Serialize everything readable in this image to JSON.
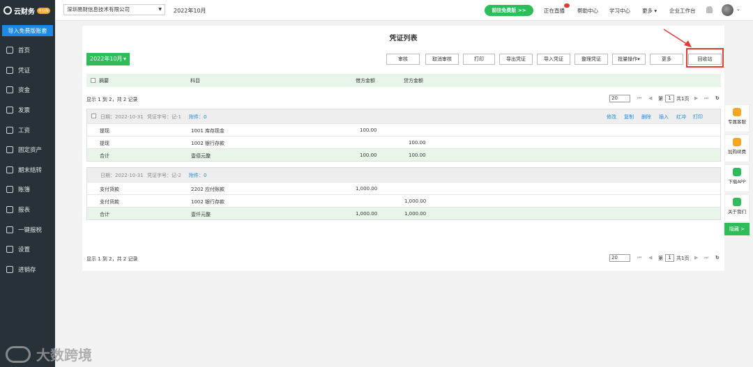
{
  "sidebar": {
    "logo_text": "云财务",
    "logo_badge": "专业版",
    "import_button": "导入免费版账套",
    "items": [
      {
        "label": "首页",
        "icon": "home-icon"
      },
      {
        "label": "凭证",
        "icon": "voucher-icon"
      },
      {
        "label": "资金",
        "icon": "funds-icon"
      },
      {
        "label": "发票",
        "icon": "invoice-icon"
      },
      {
        "label": "工资",
        "icon": "salary-icon"
      },
      {
        "label": "固定资产",
        "icon": "assets-icon"
      },
      {
        "label": "期末结转",
        "icon": "period-end-icon"
      },
      {
        "label": "账簿",
        "icon": "ledger-icon"
      },
      {
        "label": "报表",
        "icon": "report-icon"
      },
      {
        "label": "一键报税",
        "icon": "tax-icon"
      },
      {
        "label": "设置",
        "icon": "settings-icon"
      },
      {
        "label": "进销存",
        "icon": "inventory-icon"
      }
    ]
  },
  "header": {
    "company": "深圳易财信息技术有限公司",
    "period": "2022年10月",
    "free_button": "前往免费版 >>",
    "live": "正在直播",
    "help": "帮助中心",
    "learn": "学习中心",
    "more": "更多",
    "workbench": "企业工作台"
  },
  "main": {
    "title": "凭证列表",
    "period_select": "2022年10月",
    "toolbar": [
      "审核",
      "取消审核",
      "打印",
      "导出凭证",
      "导入凭证",
      "整理凭证",
      "批量操作▾",
      "更多",
      "回收站"
    ],
    "columns": {
      "summary": "摘要",
      "subject": "科目",
      "debit": "借方金额",
      "credit": "贷方金额"
    },
    "pager": {
      "info": "显示 1 到 2，共 2 记录",
      "page_size": "20",
      "page_label": "第",
      "page": "1",
      "total_pages": "共1页"
    },
    "vouchers": [
      {
        "date": "日期：2022-10-31",
        "number": "凭证字号：记-1",
        "attach": "附件：0",
        "actions": [
          "修改",
          "复制",
          "删除",
          "插入",
          "红冲",
          "打印"
        ],
        "rows": [
          {
            "summary": "提现",
            "subject": "1001 库存现金",
            "debit": "100.00",
            "credit": ""
          },
          {
            "summary": "提现",
            "subject": "1002 银行存款",
            "debit": "",
            "credit": "100.00"
          },
          {
            "summary": "合计",
            "subject": "壹佰元整",
            "debit": "100.00",
            "credit": "100.00"
          }
        ]
      },
      {
        "date": "日期：2022-10-31",
        "number": "凭证字号：记-2",
        "attach": "附件：0",
        "actions": [],
        "rows": [
          {
            "summary": "支付货款",
            "subject": "2202 应付账款",
            "debit": "1,000.00",
            "credit": ""
          },
          {
            "summary": "支付货款",
            "subject": "1002 银行存款",
            "debit": "",
            "credit": "1,000.00"
          },
          {
            "summary": "合计",
            "subject": "壹仟元整",
            "debit": "1,000.00",
            "credit": "1,000.00"
          }
        ]
      }
    ]
  },
  "float_panel": {
    "items": [
      "专属客服",
      "加购续费",
      "下载APP",
      "关于我们"
    ],
    "hide": "隐藏 >"
  },
  "watermark": "大数跨境",
  "colors": {
    "sidebar": "#263238",
    "accent": "#2ebd59",
    "link": "#1e88e5",
    "highlight": "#e53935"
  }
}
